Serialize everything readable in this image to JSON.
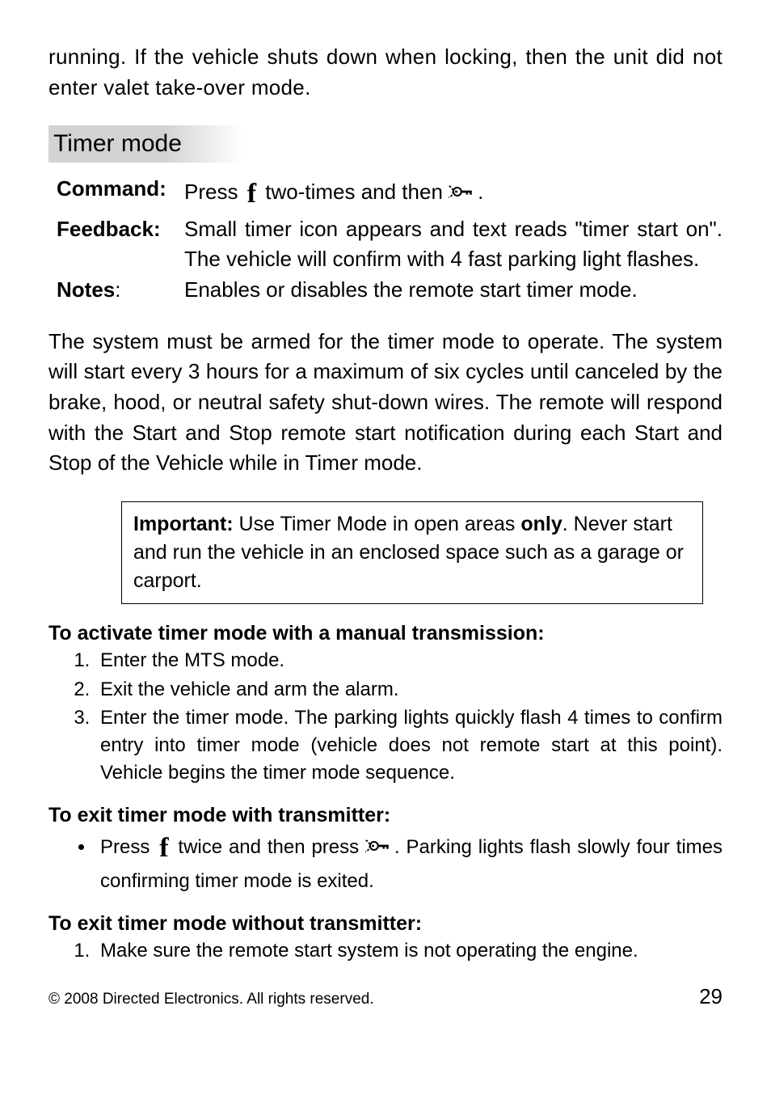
{
  "intro": "running. If the vehicle shuts down when locking, then the unit did not enter valet take-over mode.",
  "section_heading": "Timer mode",
  "defs": {
    "command_label": "Command",
    "command_before": "Press ",
    "command_mid": " two-times and then ",
    "command_after": ".",
    "feedback_label": "Feedback",
    "feedback_text": "Small timer icon appears and text reads \"timer start on\". The vehicle will confirm with 4 fast parking light flashes.",
    "notes_label": "Notes",
    "notes_text": "Enables or disables the remote start timer mode."
  },
  "body1": "The system must be armed for the timer mode to operate. The system will start every 3 hours for a maximum of six cycles until canceled by the brake, hood, or neutral safety shut-down wires. The remote will respond with the Start and Stop remote start notification during each Start and Stop of the Vehicle while in Timer mode.",
  "important": {
    "label": "Important:",
    "before_only": " Use Timer Mode in open areas ",
    "only": "only",
    "after_only": ". Never start and run the vehicle in an enclosed space such as a garage or carport."
  },
  "sub1": "To activate timer mode with a manual transmission:",
  "steps1": [
    "Enter the MTS mode.",
    "Exit the vehicle and arm the alarm.",
    "Enter the timer mode. The parking lights quickly flash 4 times to confirm entry into timer mode (vehicle does not remote start at this point). Vehicle begins the timer mode sequence."
  ],
  "sub2": "To exit timer mode with transmitter:",
  "bullet2": {
    "before": "Press ",
    "mid": " twice and then press ",
    "after": ". Parking lights flash slowly four times confirming timer mode is exited."
  },
  "sub3": "To exit timer mode without transmitter:",
  "steps3": [
    "Make sure the remote start system is not operating the engine."
  ],
  "footer": {
    "copyright": "© 2008 Directed Electronics. All rights reserved.",
    "page": "29"
  },
  "icons": {
    "f": "f"
  }
}
